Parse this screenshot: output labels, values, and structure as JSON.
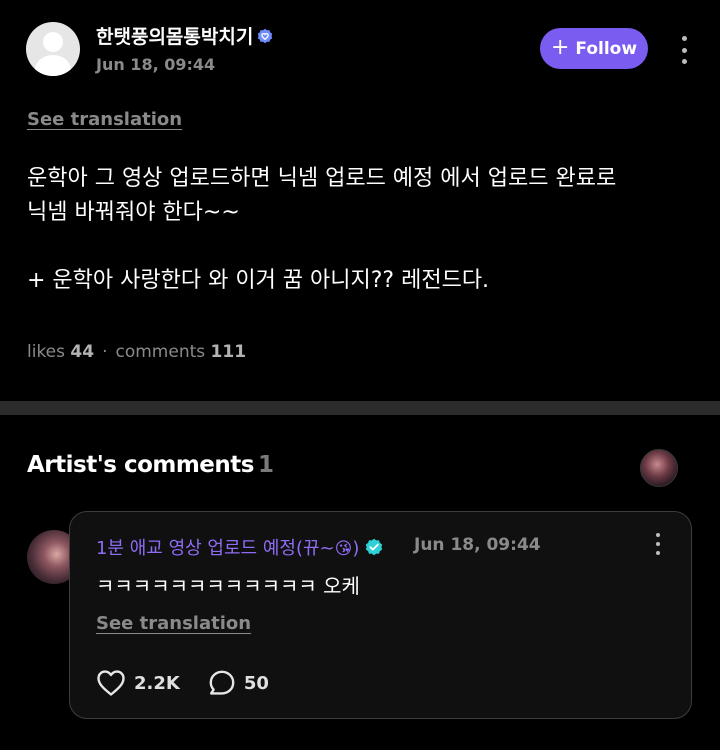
{
  "post": {
    "author": "한탯풍의몸통박치기",
    "time": "Jun 18, 09:44",
    "follow_label": "Follow",
    "see_translation": "See translation",
    "body": "운학아 그 영상 업로드하면 닉넴 업로드 예정 에서 업로드 완료로\n닉넴 바꿔줘야 한다~~\n\n+ 운학아 사랑한다 와 이거 꿈 아니지?? 레전드다.",
    "likes_label": "likes",
    "likes_count": "44",
    "comments_label": "comments",
    "comments_count": "111"
  },
  "artist_section": {
    "title": "Artist's comments",
    "count": "1"
  },
  "comment": {
    "author_text": "1분 애교 영상 업로드 예정(뀨~",
    "author_emoji": "😘",
    "author_close": ")",
    "time": "Jun 18, 09:44",
    "text": "ㅋㅋㅋㅋㅋㅋㅋㅋㅋㅋㅋㅋ 오케",
    "see_translation": "See translation",
    "likes": "2.2K",
    "replies": "50"
  },
  "colors": {
    "accent": "#7b5cf0",
    "artist_name": "#8e6cf4",
    "background": "#000000",
    "muted_text": "#8a8a8a",
    "divider": "#2b2b2b"
  },
  "icons": [
    "verified-fan-badge-icon",
    "plus-icon",
    "more-vertical-icon",
    "artist-verified-badge-icon",
    "heart-icon",
    "comment-bubble-icon"
  ]
}
